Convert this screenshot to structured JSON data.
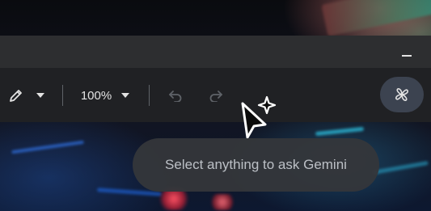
{
  "toolbar": {
    "zoom_level": "100%"
  },
  "icons": {
    "pen": "pen-icon",
    "pen_dropdown": "chevron-down-icon",
    "zoom_dropdown": "chevron-down-icon",
    "undo": "undo-icon",
    "redo": "redo-icon",
    "gemini": "gemini-spark-icon",
    "cursor": "sparkle-cursor-icon"
  },
  "tooltip": {
    "text": "Select anything to ask Gemini"
  },
  "colors": {
    "toolbar_bg": "#202124",
    "titlebar_bg": "#2d2e30",
    "gemini_button_bg": "#3c4350",
    "tooltip_bg": "#34363a"
  }
}
